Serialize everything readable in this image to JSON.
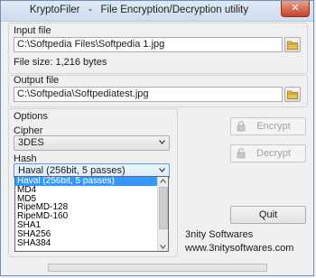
{
  "window": {
    "title": "KryptoFiler   -   File Encryption/Decryption utility",
    "close_glyph": "✕"
  },
  "input": {
    "label": "Input file",
    "path": "C:\\Softpedia Files\\Softpedia 1.jpg",
    "size_text": "File size: 1,216 bytes"
  },
  "output": {
    "label": "Output file",
    "path": "C:\\Softpedia\\Softpediatest.jpg"
  },
  "options": {
    "label": "Options",
    "cipher_label": "Cipher",
    "cipher_value": "3DES",
    "hash_label": "Hash",
    "hash_value": "Haval (256bit, 5 passes)",
    "hash_options": [
      "Haval (256bit, 5 passes)",
      "MD4",
      "MD5",
      "RipeMD-128",
      "RipeMD-160",
      "SHA1",
      "SHA256",
      "SHA384"
    ]
  },
  "actions": {
    "encrypt_label": "Encrypt",
    "decrypt_label": "Decrypt",
    "quit_label": "Quit"
  },
  "footer": {
    "company": "3nity Softwares",
    "website": "www.3nitysoftwares.com"
  },
  "progress": 0,
  "colors": {
    "selection": "#3399ff",
    "folder_icon": "#e8c04a"
  },
  "icons": {
    "folder": "folder-icon",
    "lock": "lock-icon",
    "chevron": "chevron-down-icon",
    "close": "close-icon"
  }
}
